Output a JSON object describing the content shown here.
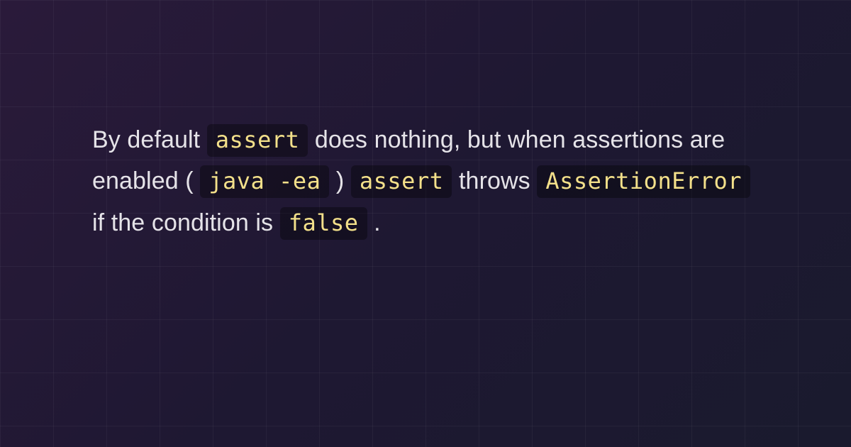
{
  "paragraph": {
    "seg1": "By default ",
    "code1": "assert",
    "seg2": " does nothing, but when assertions are enabled (",
    "code2": "java -ea",
    "seg3_close": ") ",
    "code3": "assert",
    "seg4": " throws ",
    "code4": "AssertionError",
    "seg5": " if the condition is ",
    "code5": "false",
    "seg6": "."
  }
}
